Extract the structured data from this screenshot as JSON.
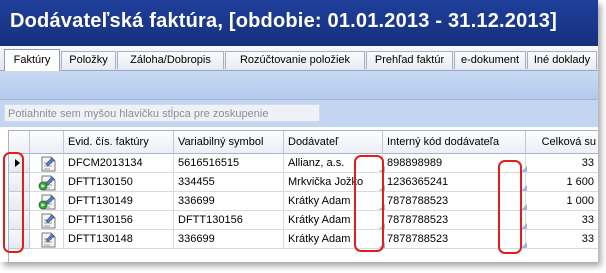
{
  "window": {
    "title": "Dodávateľská faktúra, [obdobie: 01.01.2013 - 31.12.2013]"
  },
  "tabs": [
    {
      "label": "Faktúry",
      "active": true
    },
    {
      "label": "Položky",
      "active": false
    },
    {
      "label": "Záloha/Dobropis",
      "active": false
    },
    {
      "label": "Rozúčtovanie položiek",
      "active": false
    },
    {
      "label": "Prehľad faktúr",
      "active": false
    },
    {
      "label": "e-dokument",
      "active": false
    },
    {
      "label": "Iné doklady",
      "active": false
    }
  ],
  "grouping": {
    "hint": "Potiahnite sem myšou hlavičku stĺpca pre zoskupenie"
  },
  "grid": {
    "columns": [
      "Evid. čís. faktúry",
      "Variabilný symbol",
      "Dodávateľ",
      "Interný kód dodávateľa",
      "Celková su"
    ],
    "rows": [
      {
        "selected": true,
        "evid": "DFCM2013134",
        "vs": "5616516515",
        "dodavatel": "Allianz, a.s.",
        "kod": "898898989",
        "suma": "33"
      },
      {
        "selected": false,
        "evid": "DFTT130150",
        "vs": "334455",
        "dodavatel": "Mrkvička Jožko",
        "kod": "1236365241",
        "suma": "1 600"
      },
      {
        "selected": false,
        "evid": "DFTT130149",
        "vs": "336699",
        "dodavatel": "Krátky Adam",
        "kod": "7878788523",
        "suma": "1 000"
      },
      {
        "selected": false,
        "evid": "DFTT130156",
        "vs": "DFTT130156",
        "dodavatel": "Krátky Adam",
        "kod": "7878788523",
        "suma": "33"
      },
      {
        "selected": false,
        "evid": "DFTT130148",
        "vs": "336699",
        "dodavatel": "Krátky Adam",
        "kod": "7878788523",
        "suma": "33"
      }
    ]
  },
  "icons": {
    "document": "document-icon",
    "status_ok": "green-status-icon",
    "row_pointer": "row-pointer-icon"
  },
  "colors": {
    "title_bar": "#1a3688",
    "highlight": "#e41c1c",
    "group_bar": "#c4d5f2"
  }
}
